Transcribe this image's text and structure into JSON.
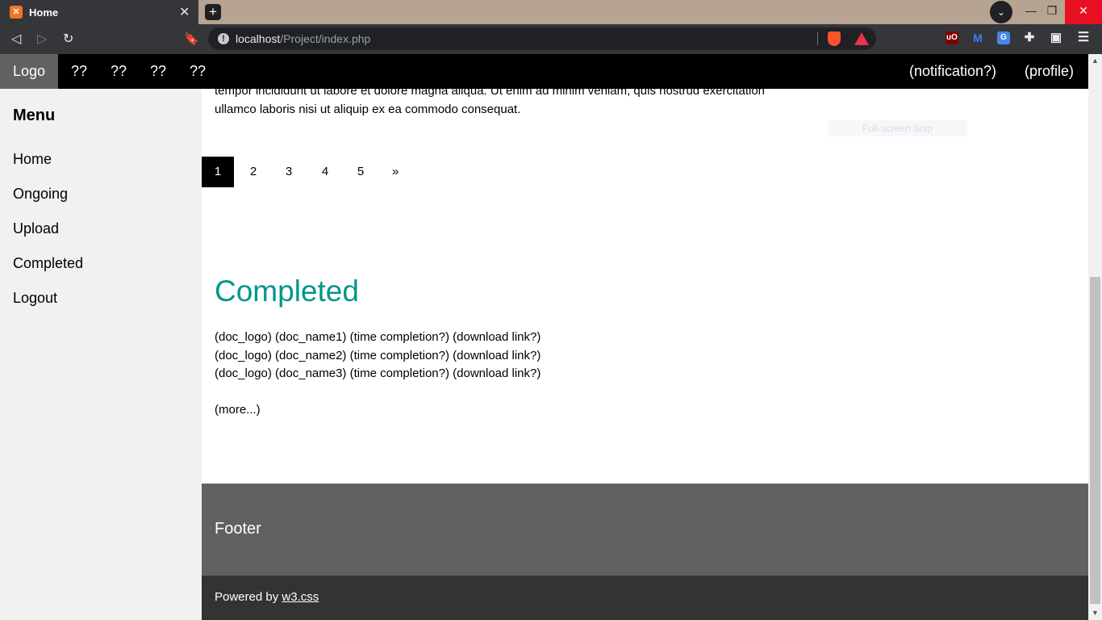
{
  "browser": {
    "tab_title": "Home",
    "tab_favicon": "xampp-icon",
    "url_host": "localhost",
    "url_path": "/Project/index.php"
  },
  "topbar": {
    "logo": "Logo",
    "items": [
      "??",
      "??",
      "??",
      "??"
    ],
    "notification": "(notification?)",
    "profile": "(profile)"
  },
  "sidebar": {
    "title": "Menu",
    "items": [
      "Home",
      "Ongoing",
      "Upload",
      "Completed",
      "Logout"
    ]
  },
  "main": {
    "lorem_line1": "tempor incididunt ut labore et dolore magna aliqua. Ut enim ad minim veniam, quis nostrud exercitation",
    "lorem_line2": "ullamco laboris nisi ut aliquip ex ea commodo consequat.",
    "snip_label": "Full-screen Snip",
    "pagination": [
      "1",
      "2",
      "3",
      "4",
      "5",
      "»"
    ],
    "active_page": "1",
    "section_title": "Completed",
    "docs": [
      "(doc_logo) (doc_name1) (time completion?) (download link?)",
      "(doc_logo) (doc_name2) (time completion?) (download link?)",
      "(doc_logo) (doc_name3) (time completion?) (download link?)"
    ],
    "more": "(more...)"
  },
  "footer": {
    "title": "Footer",
    "powered_prefix": "Powered by ",
    "powered_link": "w3.css"
  },
  "colors": {
    "accent_teal": "#009688",
    "topbar_bg": "#000000",
    "logo_bg": "#616161",
    "sidebar_bg": "#f1f1f1",
    "footer_bg": "#616161",
    "bottom_bar_bg": "#333333"
  }
}
